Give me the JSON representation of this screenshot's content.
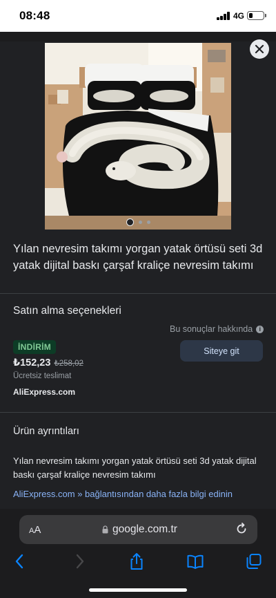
{
  "status_bar": {
    "time": "08:48",
    "network": "4G",
    "battery_level": 0.3
  },
  "product": {
    "title": "Yılan nevresim takımı yorgan yatak örtüsü seti 3d yatak dijital baskı çarşaf kraliçe nevresim takımı",
    "image_alt": "bed-with-white-snake-print-duvet",
    "carousel": {
      "total": 3,
      "active_index": 0
    }
  },
  "purchase": {
    "heading": "Satın alma seçenekleri",
    "about_results": "Bu sonuçlar hakkında",
    "badge": "İNDİRİM",
    "price": "₺152,23",
    "old_price": "₺258,02",
    "delivery": "Ücretsiz teslimat",
    "merchant": "AliExpress.com",
    "site_button": "Siteye git"
  },
  "details": {
    "heading": "Ürün ayrıntıları",
    "description": "Yılan nevresim takımı yorgan yatak örtüsü seti 3d yatak dijital baskı çarşaf kraliçe nevresim takımı",
    "more_link": "AliExpress.com » bağlantısından daha fazla bilgi edinin"
  },
  "browser": {
    "aa_small": "A",
    "aa_large": "A",
    "url": "google.com.tr"
  },
  "colors": {
    "accent_link": "#8ab4f8",
    "discount_text": "#81c995",
    "toolbar_blue": "#0a84ff"
  },
  "icons": {
    "close": "close-icon",
    "info": "info-icon",
    "lock": "lock-icon",
    "reload": "reload-icon",
    "back": "chevron-left-icon",
    "forward": "chevron-right-icon",
    "share": "share-icon",
    "bookmarks": "book-icon",
    "tabs": "tabs-icon"
  }
}
